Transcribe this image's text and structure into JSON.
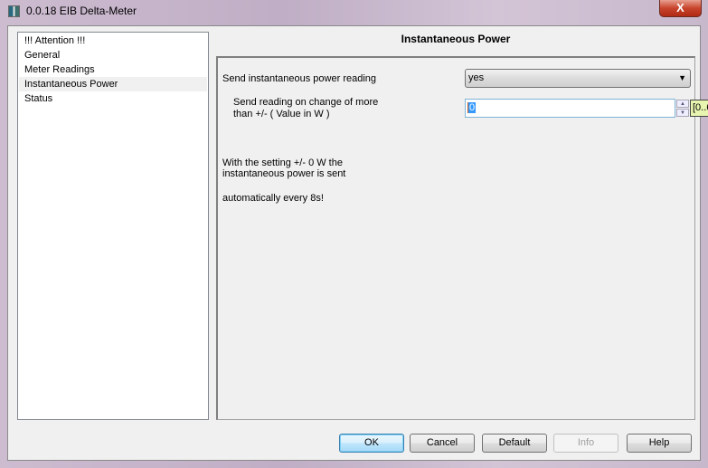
{
  "window": {
    "title": "0.0.18 EIB Delta-Meter",
    "close_label": "X"
  },
  "sidebar": {
    "items": [
      {
        "label": " !!! Attention !!!"
      },
      {
        "label": "General"
      },
      {
        "label": "Meter Readings"
      },
      {
        "label": "Instantaneous Power",
        "selected": true
      },
      {
        "label": "Status"
      }
    ]
  },
  "main": {
    "header": "Instantaneous Power",
    "send_reading": {
      "label": "Send instantaneous power reading",
      "value": "yes"
    },
    "change": {
      "label_line1": "Send reading on change of more",
      "label_line2": "than  +/-    ( Value in W )",
      "value": "0",
      "range_tooltip": "[0..6"
    },
    "info_line1": "With the setting +/- 0 W the",
    "info_line2": "instantaneous power is sent",
    "info_line3": "automatically every 8s!"
  },
  "buttons": {
    "ok": "OK",
    "cancel": "Cancel",
    "default": "Default",
    "info": "Info",
    "help": "Help"
  }
}
